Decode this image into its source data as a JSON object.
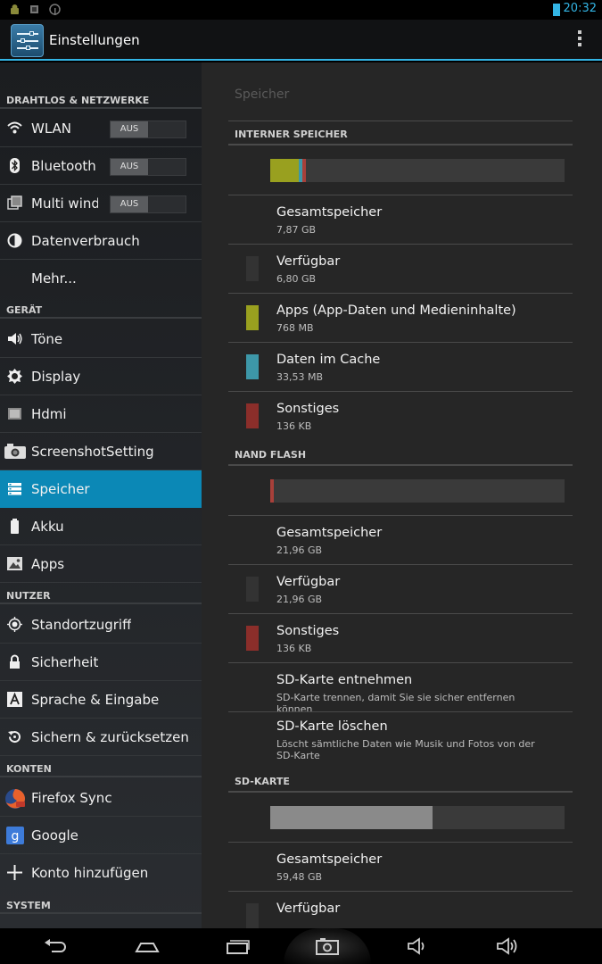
{
  "status_bar": {
    "time": "20:32"
  },
  "action_bar": {
    "title": "Einstellungen"
  },
  "left_pane": {
    "sections": {
      "wireless": "DRAHTLOS & NETZWERKE",
      "device": "GERÄT",
      "user": "NUTZER",
      "accounts": "KONTEN",
      "system": "SYSTEM"
    },
    "items": {
      "wlan": {
        "label": "WLAN",
        "toggle": "AUS",
        "icon": "wifi-icon"
      },
      "bluetooth": {
        "label": "Bluetooth",
        "toggle": "AUS",
        "icon": "bluetooth-icon"
      },
      "multiwindow": {
        "label": "Multi window",
        "toggle": "AUS",
        "icon": "multi-window-icon"
      },
      "data_usage": {
        "label": "Datenverbrauch",
        "icon": "data-usage-icon"
      },
      "more": {
        "label": "Mehr..."
      },
      "sound": {
        "label": "Töne",
        "icon": "speaker-icon"
      },
      "display": {
        "label": "Display",
        "icon": "brightness-icon"
      },
      "hdmi": {
        "label": "Hdmi",
        "icon": "hdmi-icon"
      },
      "screenshot": {
        "label": "ScreenshotSetting",
        "icon": "camera-icon"
      },
      "storage": {
        "label": "Speicher",
        "icon": "storage-icon"
      },
      "battery": {
        "label": "Akku",
        "icon": "battery-icon"
      },
      "apps": {
        "label": "Apps",
        "icon": "apps-icon"
      },
      "location": {
        "label": "Standortzugriff",
        "icon": "location-icon"
      },
      "security": {
        "label": "Sicherheit",
        "icon": "lock-icon"
      },
      "language": {
        "label": "Sprache & Eingabe",
        "icon": "language-icon"
      },
      "backup": {
        "label": "Sichern & zurücksetzen",
        "icon": "backup-icon"
      },
      "firefox_sync": {
        "label": "Firefox Sync",
        "icon": "firefox-icon"
      },
      "google": {
        "label": "Google",
        "icon": "google-icon"
      },
      "add_account": {
        "label": "Konto hinzufügen",
        "icon": "plus-icon"
      }
    }
  },
  "right_pane": {
    "title": "Speicher",
    "internal": {
      "header": "INTERNER SPEICHER",
      "total": {
        "label": "Gesamtspeicher",
        "value": "7,87 GB"
      },
      "available": {
        "label": "Verfügbar",
        "value": "6,80 GB"
      },
      "apps": {
        "label": "Apps (App-Daten und Medieninhalte)",
        "value": "768 MB"
      },
      "cache": {
        "label": "Daten im Cache",
        "value": "33,53 MB"
      },
      "misc": {
        "label": "Sonstiges",
        "value": "136 KB"
      }
    },
    "nand": {
      "header": "NAND FLASH",
      "total": {
        "label": "Gesamtspeicher",
        "value": "21,96 GB"
      },
      "available": {
        "label": "Verfügbar",
        "value": "21,96 GB"
      },
      "misc": {
        "label": "Sonstiges",
        "value": "136 KB"
      },
      "unmount": {
        "label": "SD-Karte entnehmen",
        "desc": "SD-Karte trennen, damit Sie sie sicher entfernen können"
      },
      "erase": {
        "label": "SD-Karte löschen",
        "desc": "Löscht sämtliche Daten wie Musik und Fotos von der SD-Karte"
      }
    },
    "sdcard": {
      "header": "SD-KARTE",
      "total": {
        "label": "Gesamtspeicher",
        "value": "59,48 GB"
      },
      "available": {
        "label": "Verfügbar"
      }
    }
  },
  "colors": {
    "accent": "#33b5e5",
    "selected": "#0b88b6",
    "apps": "#99a01f",
    "cache": "#3d97a8",
    "misc": "#8b2e2a",
    "available": "#333333",
    "sd_used": "#8a8a8a"
  },
  "nav_bar": {
    "buttons": [
      "back-icon",
      "home-icon",
      "recents-icon",
      "screenshot-icon",
      "volume-down-icon",
      "volume-up-icon"
    ]
  }
}
